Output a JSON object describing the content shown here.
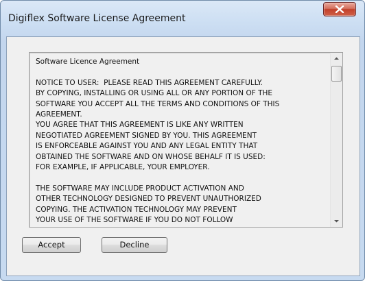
{
  "window": {
    "title": "Digiflex Software License Agreement",
    "close_icon": "close-x-icon"
  },
  "license": {
    "text": "Software Licence Agreement\n\nNOTICE TO USER:  PLEASE READ THIS AGREEMENT CAREFULLY.\nBY COPYING, INSTALLING OR USING ALL OR ANY PORTION OF THE\nSOFTWARE YOU ACCEPT ALL THE TERMS AND CONDITIONS OF THIS\nAGREEMENT.\nYOU AGREE THAT THIS AGREEMENT IS LIKE ANY WRITTEN\nNEGOTIATED AGREEMENT SIGNED BY YOU. THIS AGREEMENT\nIS ENFORCEABLE AGAINST YOU AND ANY LEGAL ENTITY THAT\nOBTAINED THE SOFTWARE AND ON WHOSE BEHALF IT IS USED:\nFOR EXAMPLE, IF APPLICABLE, YOUR EMPLOYER.\n\nTHE SOFTWARE MAY INCLUDE PRODUCT ACTIVATION AND\nOTHER TECHNOLOGY DESIGNED TO PREVENT UNAUTHORIZED\nCOPYING. THE ACTIVATION TECHNOLOGY MAY PREVENT\nYOUR USE OF THE SOFTWARE IF YOU DO NOT FOLLOW",
    "scroll_position": 0.0
  },
  "buttons": {
    "accept": "Accept",
    "decline": "Decline"
  },
  "colors": {
    "close_button": "#c7412b",
    "frame": "#c7daf0",
    "client": "#f0f0f0"
  }
}
